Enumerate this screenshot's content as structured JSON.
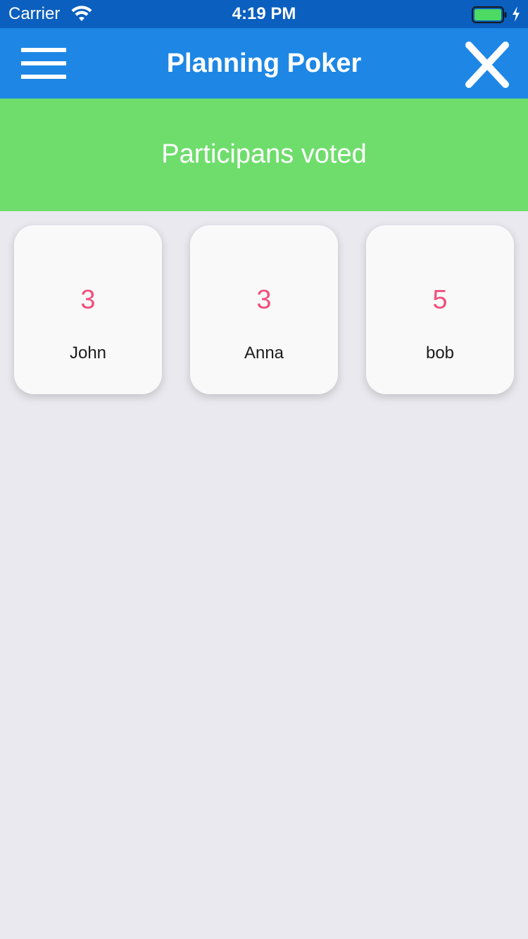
{
  "status_bar": {
    "carrier": "Carrier",
    "time": "4:19 PM",
    "battery_color": "#4cd964"
  },
  "nav": {
    "title": "Planning Poker",
    "menu_icon": "hamburger-menu-icon",
    "close_icon": "close-icon",
    "background": "#1e87e5"
  },
  "banner": {
    "text": "Participans voted",
    "background": "#6fdd6c"
  },
  "votes": [
    {
      "value": "3",
      "name": "John"
    },
    {
      "value": "3",
      "name": "Anna"
    },
    {
      "value": "5",
      "name": "bob"
    }
  ],
  "colors": {
    "vote_value": "#f0507e",
    "page_background": "#e9e9ef"
  }
}
